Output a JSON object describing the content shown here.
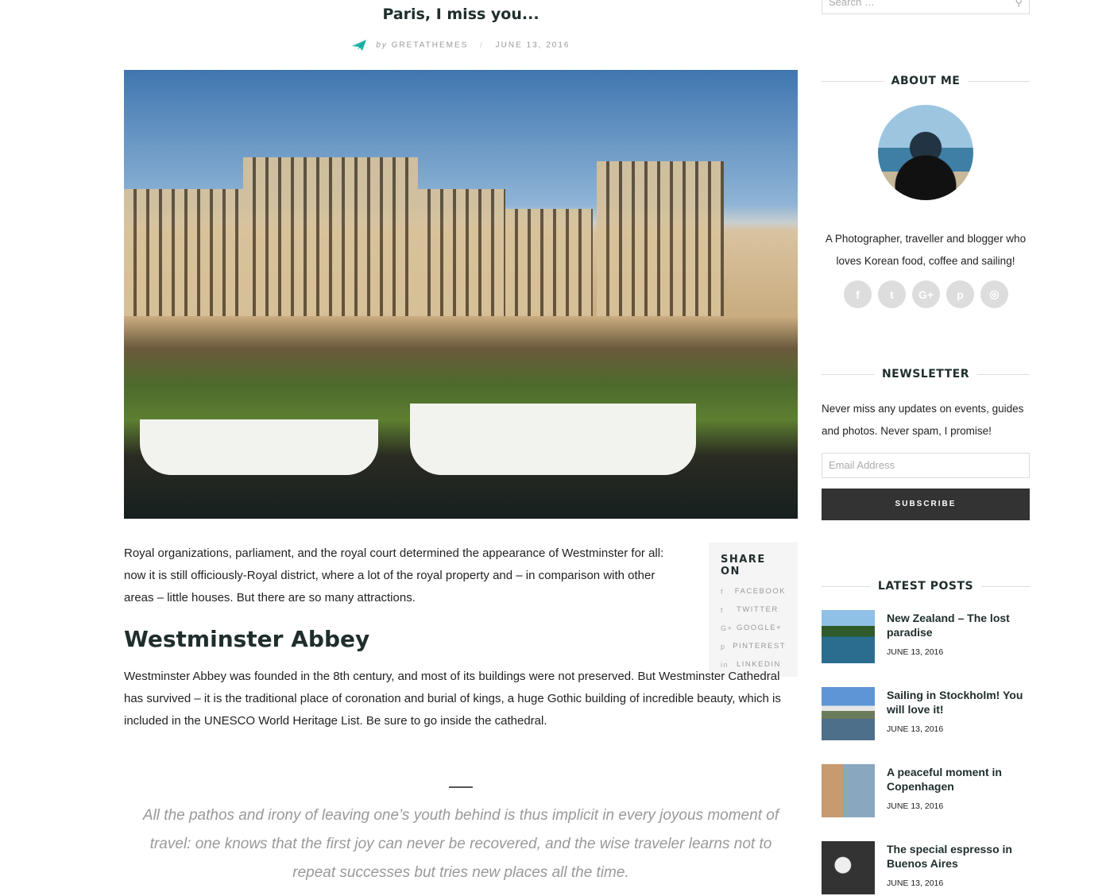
{
  "post": {
    "title": "Paris, I miss you...",
    "by": "by",
    "author": "GRETATHEMES",
    "date": "JUNE 13, 2016",
    "intro": "Royal organizations, parliament, and the royal court determined the appearance of Westminster for all: now it is still officiously-Royal district, where a lot of the royal property and – in comparison with other areas – little houses. But there are so many attractions.",
    "heading": "Westminster Abbey",
    "body": "Westminster Abbey was founded in the 8th century, and most of its buildings were not preserved. But Westminster Cathedral has survived – it is the traditional place of coronation and burial of kings, a huge Gothic building of incredible beauty, which is included in the UNESCO World Heritage List. Be sure to go inside the cathedral.",
    "quote": "All the pathos and irony of leaving one’s youth behind is thus implicit in every joyous moment of travel: one knows that the first joy can never be recovered, and the wise traveler learns not to repeat successes but tries new places all the time."
  },
  "share": {
    "title": "SHARE ON",
    "items": [
      {
        "icon": "facebook-icon",
        "glyph": "f",
        "label": "FACEBOOK"
      },
      {
        "icon": "twitter-icon",
        "glyph": "t",
        "label": "TWITTER"
      },
      {
        "icon": "google-plus-icon",
        "glyph": "G+",
        "label": "GOOGLE+"
      },
      {
        "icon": "pinterest-icon",
        "glyph": "p",
        "label": "PINTEREST"
      },
      {
        "icon": "linkedin-icon",
        "glyph": "in",
        "label": "LINKEDIN"
      }
    ]
  },
  "sidebar": {
    "search_placeholder": "Search …",
    "about_title": "ABOUT ME",
    "about_text": "A Photographer, traveller and blogger who loves Korean food, coffee and sailing!",
    "socials": [
      {
        "icon": "facebook-icon",
        "glyph": "f"
      },
      {
        "icon": "twitter-icon",
        "glyph": "t"
      },
      {
        "icon": "google-plus-icon",
        "glyph": "G+"
      },
      {
        "icon": "pinterest-icon",
        "glyph": "p"
      },
      {
        "icon": "instagram-icon",
        "glyph": "◎"
      }
    ],
    "newsletter_title": "NEWSLETTER",
    "newsletter_text": "Never miss any updates on events, guides and photos. Never spam, I promise!",
    "email_placeholder": "Email Address",
    "subscribe": "SUBSCRIBE",
    "latest_title": "LATEST POSTS",
    "posts": [
      {
        "title": "New Zealand – The lost paradise",
        "date": "JUNE 13, 2016"
      },
      {
        "title": "Sailing in Stockholm! You will love it!",
        "date": "JUNE 13, 2016"
      },
      {
        "title": "A peaceful moment in Copenhagen",
        "date": "JUNE 13, 2016"
      },
      {
        "title": "The special espresso in Buenos Aires",
        "date": "JUNE 13, 2016"
      }
    ]
  },
  "colors": {
    "accent": "#1fb5ac",
    "heading": "#1f2d2d",
    "button": "#333333"
  }
}
